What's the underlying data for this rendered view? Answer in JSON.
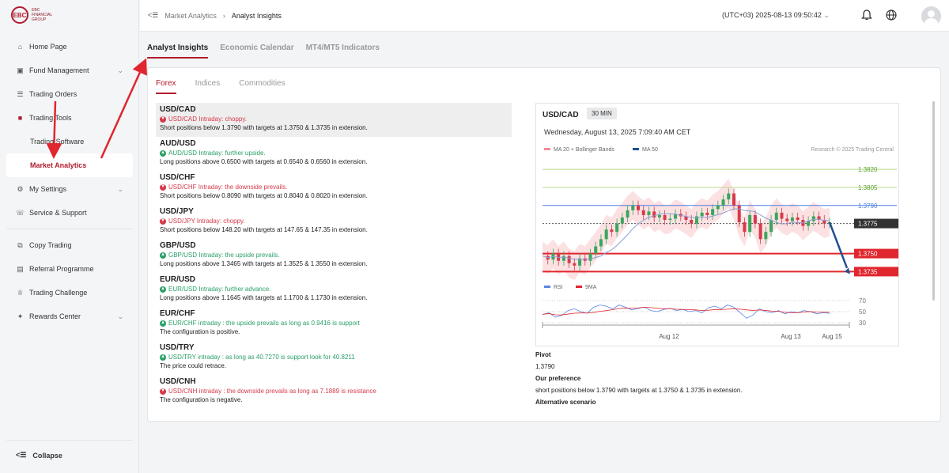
{
  "brand": {
    "logo_mark": "EBC",
    "logo_text": "EBC FINANCIAL GROUP"
  },
  "sidebar": {
    "items": [
      {
        "label": "Home Page",
        "icon": "home-icon"
      },
      {
        "label": "Fund Management",
        "icon": "wallet-icon"
      },
      {
        "label": "Trading Orders",
        "icon": "orders-icon"
      },
      {
        "label": "Trading Tools",
        "icon": "tools-icon"
      },
      {
        "label": "Trading Software"
      },
      {
        "label": "Market Analytics"
      },
      {
        "label": "My Settings",
        "icon": "settings-icon"
      },
      {
        "label": "Service & Support",
        "icon": "support-icon"
      },
      {
        "label": "Copy Trading",
        "icon": "copy-icon"
      },
      {
        "label": "Referral Programme",
        "icon": "referral-icon"
      },
      {
        "label": "Trading Challenge",
        "icon": "trophy-icon"
      },
      {
        "label": "Rewards Center",
        "icon": "gift-icon"
      }
    ],
    "collapse_label": "Collapse"
  },
  "breadcrumb": {
    "parent": "Market Analytics",
    "current": "Analyst Insights"
  },
  "header": {
    "datetime": "(UTC+03)  2025-08-13 09:50:42"
  },
  "tabs": [
    "Analyst Insights",
    "Economic Calendar",
    "MT4/MT5 Indicators"
  ],
  "subtabs": [
    "Forex",
    "Indices",
    "Commodities"
  ],
  "pairs": [
    {
      "name": "USD/CAD",
      "headline": "USD/CAD Intraday: choppy.",
      "dir": "neg",
      "desc": "Short positions below 1.3790 with targets at 1.3750 & 1.3735 in extension."
    },
    {
      "name": "AUD/USD",
      "headline": "AUD/USD Intraday: further upside.",
      "dir": "pos",
      "desc": "Long positions above 0.6500 with targets at 0.6540 & 0.6560 in extension."
    },
    {
      "name": "USD/CHF",
      "headline": "USD/CHF Intraday: the downside prevails.",
      "dir": "neg",
      "desc": "Short positions below 0.8090 with targets at 0.8040 & 0.8020 in extension."
    },
    {
      "name": "USD/JPY",
      "headline": "USD/JPY Intraday: choppy.",
      "dir": "neg",
      "desc": "Short positions below 148.20 with targets at 147.65 & 147.35 in extension."
    },
    {
      "name": "GBP/USD",
      "headline": "GBP/USD Intraday: the upside prevails.",
      "dir": "pos",
      "desc": "Long positions above 1.3465 with targets at 1.3525 & 1.3550 in extension."
    },
    {
      "name": "EUR/USD",
      "headline": "EUR/USD Intraday: further advance.",
      "dir": "pos",
      "desc": "Long positions above 1.1645 with targets at 1.1700 & 1.1730 in extension."
    },
    {
      "name": "EUR/CHF",
      "headline": "EUR/CHF intraday : the upside prevails as long as 0.9416 is support",
      "dir": "pos",
      "desc": "The configuration is positive."
    },
    {
      "name": "USD/TRY",
      "headline": "USD/TRY intraday : as long as 40.7270 is support look for 40.8211",
      "dir": "pos",
      "desc": "The price could retrace."
    },
    {
      "name": "USD/CNH",
      "headline": "USD/CNH intraday : the downside prevails as long as 7.1889 is resistance",
      "dir": "neg",
      "desc": "The configuration is negative."
    }
  ],
  "chart_panel": {
    "pair": "USD/CAD",
    "timeframe": "30 MIN",
    "date": "Wednesday, August 13, 2025 7:09:40 AM CET",
    "legend": [
      "MA 20 + Bollinger Bands",
      "MA 50"
    ],
    "credit": "Research © 2025 Trading Central",
    "rsi_legend": [
      "RSI",
      "9MA"
    ]
  },
  "chart_data": {
    "type": "line",
    "x_ticks": [
      "Aug 12",
      "Aug 13",
      "Aug 15"
    ],
    "price_levels": [
      {
        "value": "1.3820",
        "kind": "target-up"
      },
      {
        "value": "1.3805",
        "kind": "target-up"
      },
      {
        "value": "1.3790",
        "kind": "pivot"
      },
      {
        "value": "1.3775",
        "kind": "last"
      },
      {
        "value": "1.3750",
        "kind": "target"
      },
      {
        "value": "1.3735",
        "kind": "target"
      }
    ],
    "rsi_ticks": [
      "70",
      "50",
      "30"
    ],
    "price_series": [
      1.3748,
      1.3745,
      1.375,
      1.3744,
      1.3748,
      1.3742,
      1.374,
      1.3746,
      1.3744,
      1.375,
      1.3756,
      1.3762,
      1.377,
      1.3768,
      1.3775,
      1.378,
      1.3786,
      1.379,
      1.3786,
      1.3782,
      1.3785,
      1.378,
      1.3782,
      1.3778,
      1.3779,
      1.3783,
      1.3781,
      1.3778,
      1.3775,
      1.3781,
      1.3784,
      1.3782,
      1.3787,
      1.379,
      1.3795,
      1.38,
      1.379,
      1.3776,
      1.3768,
      1.3782,
      1.3775,
      1.3762,
      1.3768,
      1.3778,
      1.3784,
      1.3779,
      1.3777,
      1.378,
      1.3778,
      1.3773,
      1.3777,
      1.3781,
      1.3778,
      1.3775,
      1.3776
    ],
    "rsi_series": [
      45,
      48,
      40,
      43,
      52,
      55,
      50,
      47,
      58,
      62,
      60,
      55,
      62,
      58,
      53,
      56,
      58,
      52,
      50,
      54,
      56,
      52,
      54,
      50,
      52,
      48,
      57,
      60,
      55,
      62,
      58,
      48,
      38,
      44,
      55,
      50,
      48,
      52,
      46,
      50,
      48,
      52,
      50,
      46,
      48,
      47
    ]
  },
  "detail": {
    "pivot_label": "Pivot",
    "pivot_value": "1.3790",
    "pref_label": "Our preference",
    "pref_value": "short positions below 1.3790 with targets at 1.3750 & 1.3735 in extension.",
    "alt_label": "Alternative scenario"
  }
}
